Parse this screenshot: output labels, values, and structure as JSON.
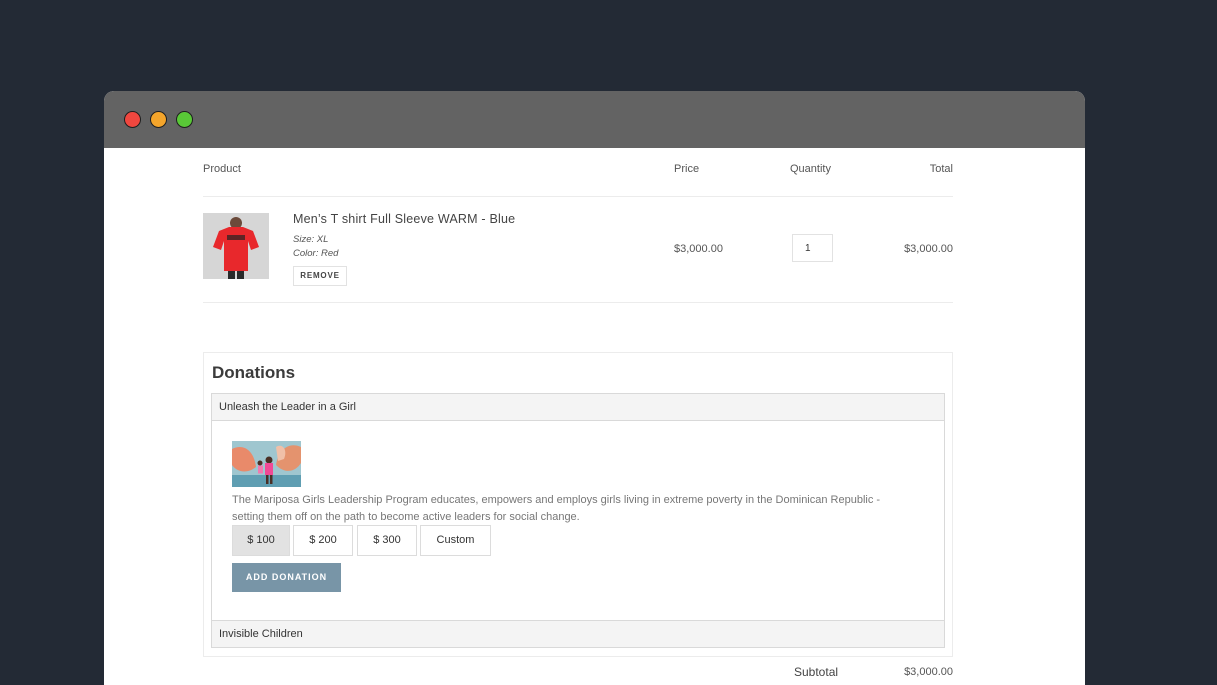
{
  "window": {
    "controls": [
      "close",
      "minimize",
      "maximize"
    ]
  },
  "cart": {
    "headers": {
      "product": "Product",
      "price": "Price",
      "quantity": "Quantity",
      "total": "Total"
    },
    "item": {
      "name": "Men’s T shirt Full Sleeve WARM - Blue",
      "size": "Size: XL",
      "color": "Color: Red",
      "remove_label": "REMOVE",
      "price": "$3,000.00",
      "quantity": "1",
      "total": "$3,000.00"
    }
  },
  "donations": {
    "title": "Donations",
    "causes": [
      {
        "name": "Unleash the Leader in a Girl",
        "expanded": true,
        "description": "The Mariposa Girls Leadership Program educates, empowers and employs girls living in extreme poverty in the Dominican Republic - setting them off on the path to become active leaders for social change.",
        "amounts": [
          "$ 100",
          "$ 200",
          "$ 300",
          "Custom"
        ],
        "selected_amount": "$ 100",
        "add_label": "ADD DONATION"
      },
      {
        "name": "Invisible Children",
        "expanded": false
      }
    ]
  },
  "summary": {
    "subtotal_label": "Subtotal",
    "subtotal_value": "$3,000.00"
  },
  "colors": {
    "background": "#232a35",
    "titlebar": "#636363",
    "add_button": "#7895a7"
  }
}
